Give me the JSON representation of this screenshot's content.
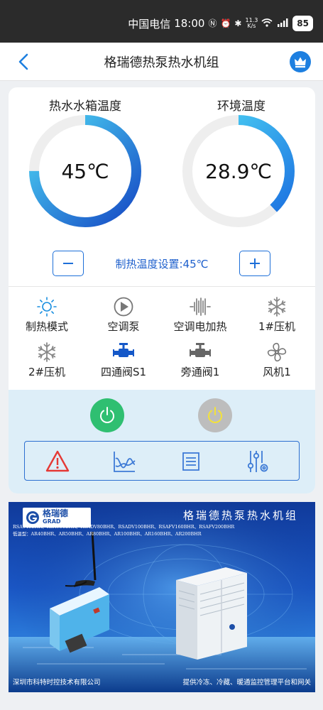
{
  "status_bar": {
    "carrier": "中国电信",
    "time": "18:00",
    "net_speed_value": "11.3",
    "net_speed_unit": "K/s",
    "battery": "85"
  },
  "header": {
    "title": "格瑞德热泵热水机组",
    "back_icon": "chevron-left-icon",
    "badge_icon": "crown-icon",
    "accent": "#1d7fe0"
  },
  "gauges": {
    "tank": {
      "label": "热水水箱温度",
      "value": "45℃",
      "fill_fraction": 0.75
    },
    "ambient": {
      "label": "环境温度",
      "value": "28.9℃",
      "fill_fraction": 0.38
    }
  },
  "setpoint": {
    "label": "制热温度设置:45℃",
    "minus_icon": "minus-icon",
    "plus_icon": "plus-icon"
  },
  "status_items": [
    {
      "label": "制热模式",
      "icon": "sun-icon"
    },
    {
      "label": "空调泵",
      "icon": "pump-icon"
    },
    {
      "label": "空调电加热",
      "icon": "electric-heater-icon"
    },
    {
      "label": "1#压机",
      "icon": "snowflake-icon"
    },
    {
      "label": "2#压机",
      "icon": "snowflake-icon"
    },
    {
      "label": "四通阀S1",
      "icon": "valve-icon"
    },
    {
      "label": "旁通阀1",
      "icon": "valve-icon"
    },
    {
      "label": "风机1",
      "icon": "fan-icon"
    }
  ],
  "controls": {
    "power_on_color": "#2fbf71",
    "power_off_color": "#bdbdbd",
    "tools": [
      "alarm-icon",
      "trend-chart-icon",
      "list-icon",
      "settings-sliders-icon"
    ]
  },
  "banner": {
    "logo_text": "格瑞德",
    "logo_sub": "GRAD",
    "title": "格瑞德热泵热水机组",
    "models_line1": "RSAV40BHR、RSAV50BHR、RSADV80BHR、RSADV100BHR、RSAFV160BHR、RSAFV200BHR",
    "models_line2": "低温型：AR40BHR、AR50BHR、AR80BHR、AR100BHR、AR160BHR、AR200BHR",
    "footer_left": "深圳市科特时控技术有限公司",
    "footer_right": "提供冷冻、冷藏、暖通监控管理平台和网关"
  }
}
